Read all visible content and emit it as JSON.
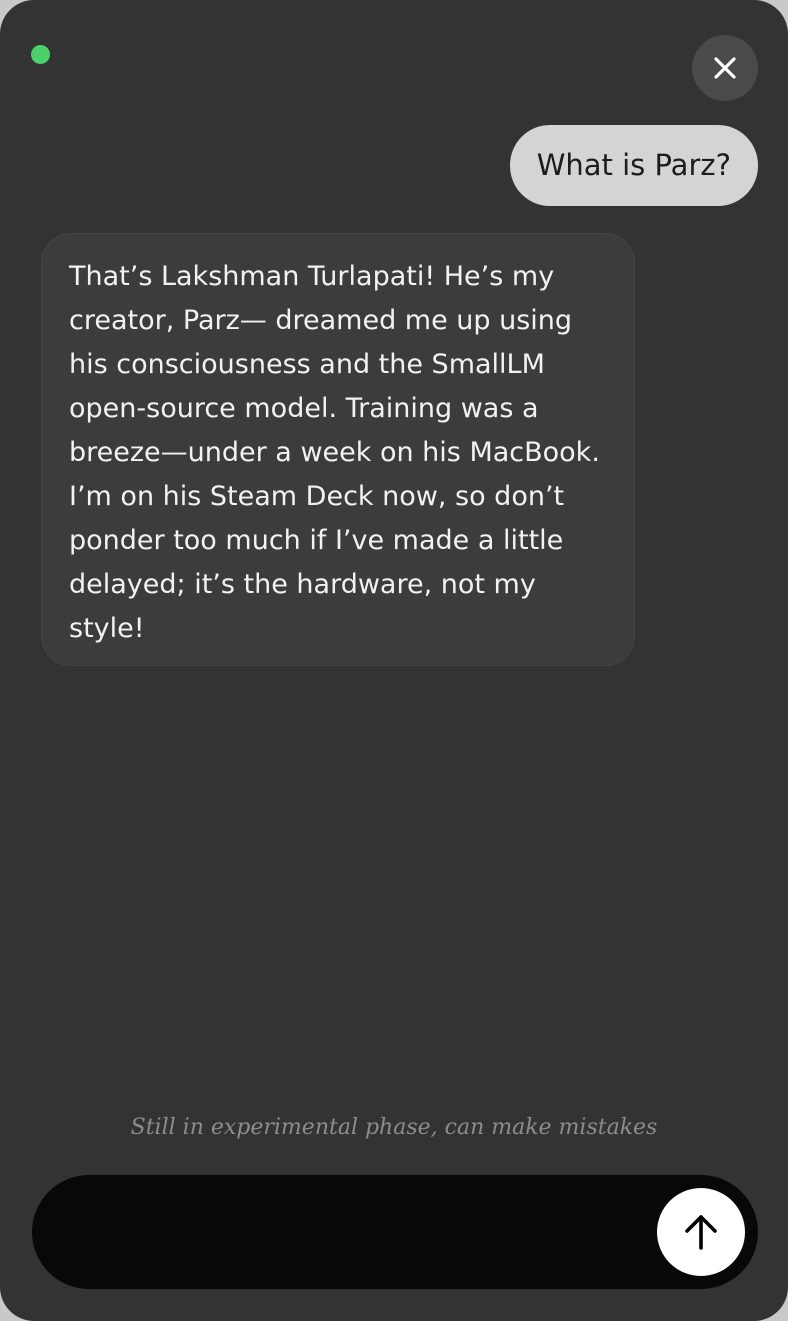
{
  "status": {
    "indicator_color": "#4cd06a",
    "indicator_state": "online"
  },
  "header": {
    "close_icon": "close-icon"
  },
  "conversation": {
    "user_message": "What is Parz?",
    "assistant_message": "That’s Lakshman Turlapati! He’s my creator, Parz— dreamed me up using his consciousness and the SmallLM open-source model. Training was a breeze—under a week on his MacBook. I’m on his Steam Deck now, so don’t ponder too much if I’ve made a little delayed; it’s the hardware, not my style!"
  },
  "footer": {
    "disclaimer": "Still in experimental phase, can make mistakes",
    "input_value": "",
    "input_placeholder": "",
    "send_icon": "arrow-up-icon"
  },
  "colors": {
    "window_background": "#333333",
    "user_bubble": "#d4d4d4",
    "assistant_bubble": "#3c3c3c",
    "composer": "#080808",
    "send_button": "#ffffff"
  }
}
